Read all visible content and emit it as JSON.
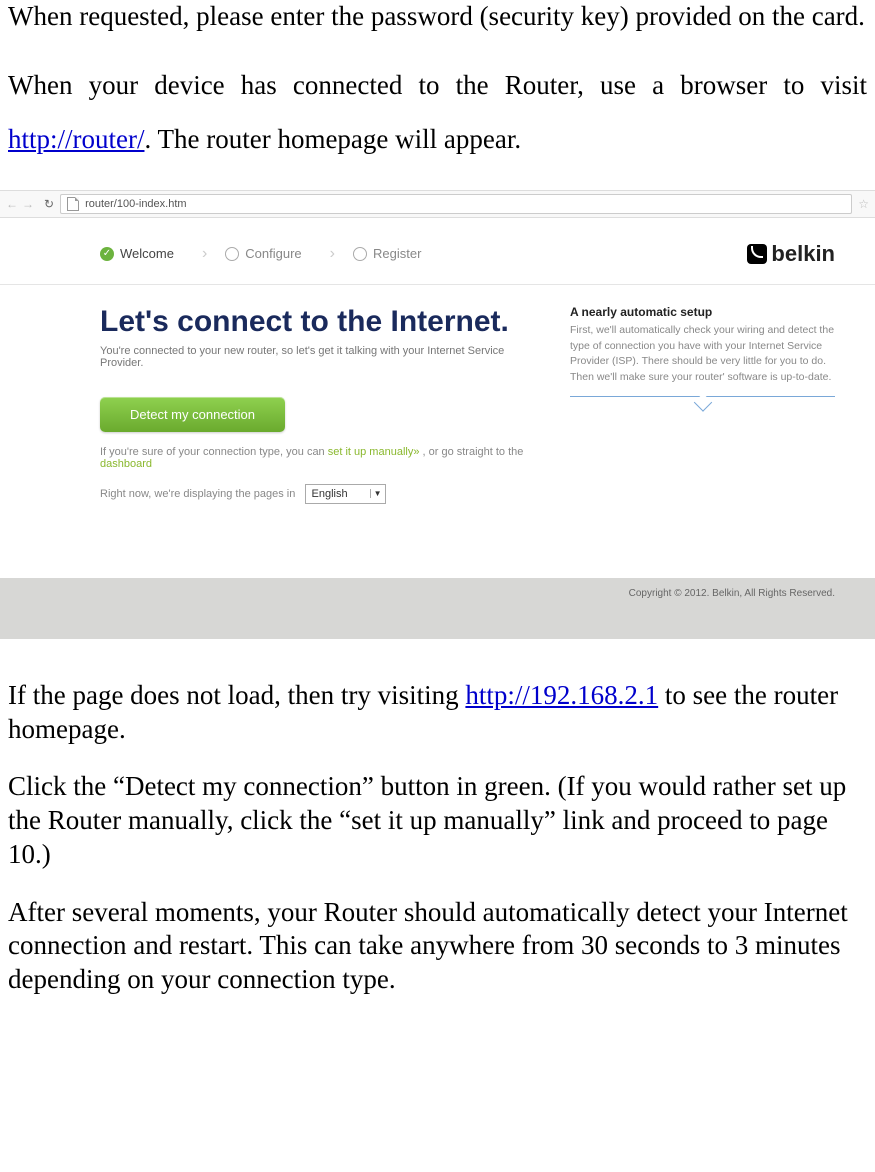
{
  "doc": {
    "p1": "When requested, please enter the password (security key) provided on the card.",
    "p2a": "When your device has connected to the Router, use a browser to visit ",
    "p2_link": "http://router/",
    "p2b": ". The router homepage will appear.",
    "p3a": "If the page does not load, then try visiting ",
    "p3_link": "http://192.168.2.1",
    "p3b": " to see the router homepage.",
    "p4": "Click the “Detect my connection” button in green. (If you would rather set up the Router manually, click the “set it up manually” link and proceed to page 10.)",
    "p5": "After several moments, your Router should automatically detect your Internet connection and restart. This can take anywhere from 30 seconds to 3 minutes depending on your connection type."
  },
  "browser": {
    "url": "router/100-index.htm"
  },
  "steps": {
    "s1": "Welcome",
    "s2": "Configure",
    "s3": "Register"
  },
  "logo": "belkin",
  "main": {
    "headline": "Let's connect to the Internet.",
    "subhead": "You're connected to your new router, so let's get it talking with your Internet Service Provider.",
    "button": "Detect my connection",
    "line1a": "If you're sure of your connection type, you can ",
    "line1_link": "set it up manually»",
    "line1b": " , or go straight to the ",
    "line1_link2": "dashboard",
    "line2a": "Right now, we're displaying the pages in",
    "language": "English"
  },
  "side": {
    "title": "A nearly automatic setup",
    "text": "First, we'll automatically check your wiring and detect the type of connection you have with your Internet Service Provider (ISP). There should be very little for you to do. Then we'll make sure your router' software is up-to-date."
  },
  "footer": "Copyright © 2012. Belkin, All Rights Reserved."
}
